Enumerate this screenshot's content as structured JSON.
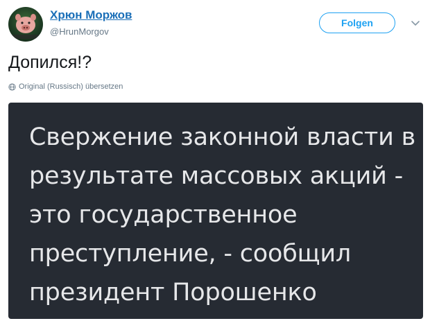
{
  "author": {
    "name": "Хрюн Моржов",
    "handle": "@HrunMorgov",
    "avatar_icon": "pig-avatar-icon"
  },
  "actions": {
    "follow_label": "Folgen",
    "menu_icon": "chevron-down-icon"
  },
  "tweet": {
    "text": "Допился!?",
    "translate_label": "Original (Russisch) übersetzen",
    "translate_icon": "globe-icon"
  },
  "media": {
    "lines": [
      "Свержение законной власти в",
      "результате массовых акций -",
      "это государственное",
      "преступление, - сообщил",
      "президент Порошенко"
    ],
    "background_color": "#262b33",
    "text_color": "#e6e7e9"
  },
  "colors": {
    "link": "#1b6fb8",
    "accent": "#1da1f2",
    "muted": "#657786"
  }
}
